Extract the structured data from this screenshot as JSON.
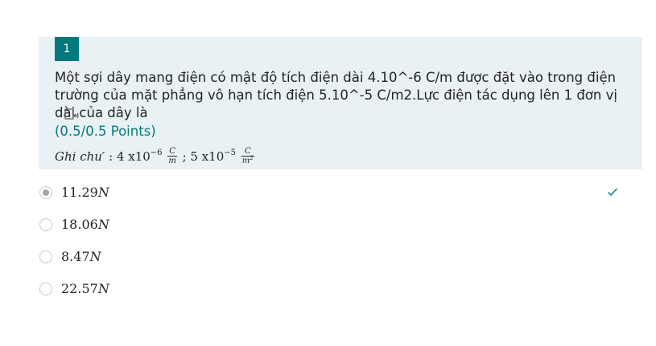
{
  "question": {
    "number": "1",
    "text": "Một sợi dây mang điện có mật độ tích điện dài 4.10^-6 C/m được đặt vào trong điện trường của mặt phẳng vô hạn tích điện 5.10^-5 C/m2.Lực điện tác dụng lên 1 đơn vị dài của dây là",
    "points": "(0.5/0.5 Points)",
    "note": {
      "label": "Ghi chu′",
      "colon": " :  ",
      "first_value": "4 x10",
      "first_exp": "−6",
      "first_frac_num": "C",
      "first_frac_den": "m",
      "separator": " ;  ",
      "second_value": "5 x10",
      "second_exp": "−5",
      "second_frac_num": "C",
      "second_frac_den": "m",
      "second_frac_den_exp": "2"
    }
  },
  "options": [
    {
      "value": "11.29",
      "unit": "N",
      "selected": true,
      "correct": true
    },
    {
      "value": "18.06",
      "unit": "N",
      "selected": false,
      "correct": false
    },
    {
      "value": "8.47",
      "unit": "N",
      "selected": false,
      "correct": false
    },
    {
      "value": "22.57",
      "unit": "N",
      "selected": false,
      "correct": false
    }
  ],
  "icons": {
    "reader": "immersive-reader-icon",
    "correct": "checkmark-icon"
  },
  "colors": {
    "accent": "#03787c",
    "card_background": "#e8f1f3",
    "selected_radio": "#a6a6a6",
    "text": "#242424"
  }
}
